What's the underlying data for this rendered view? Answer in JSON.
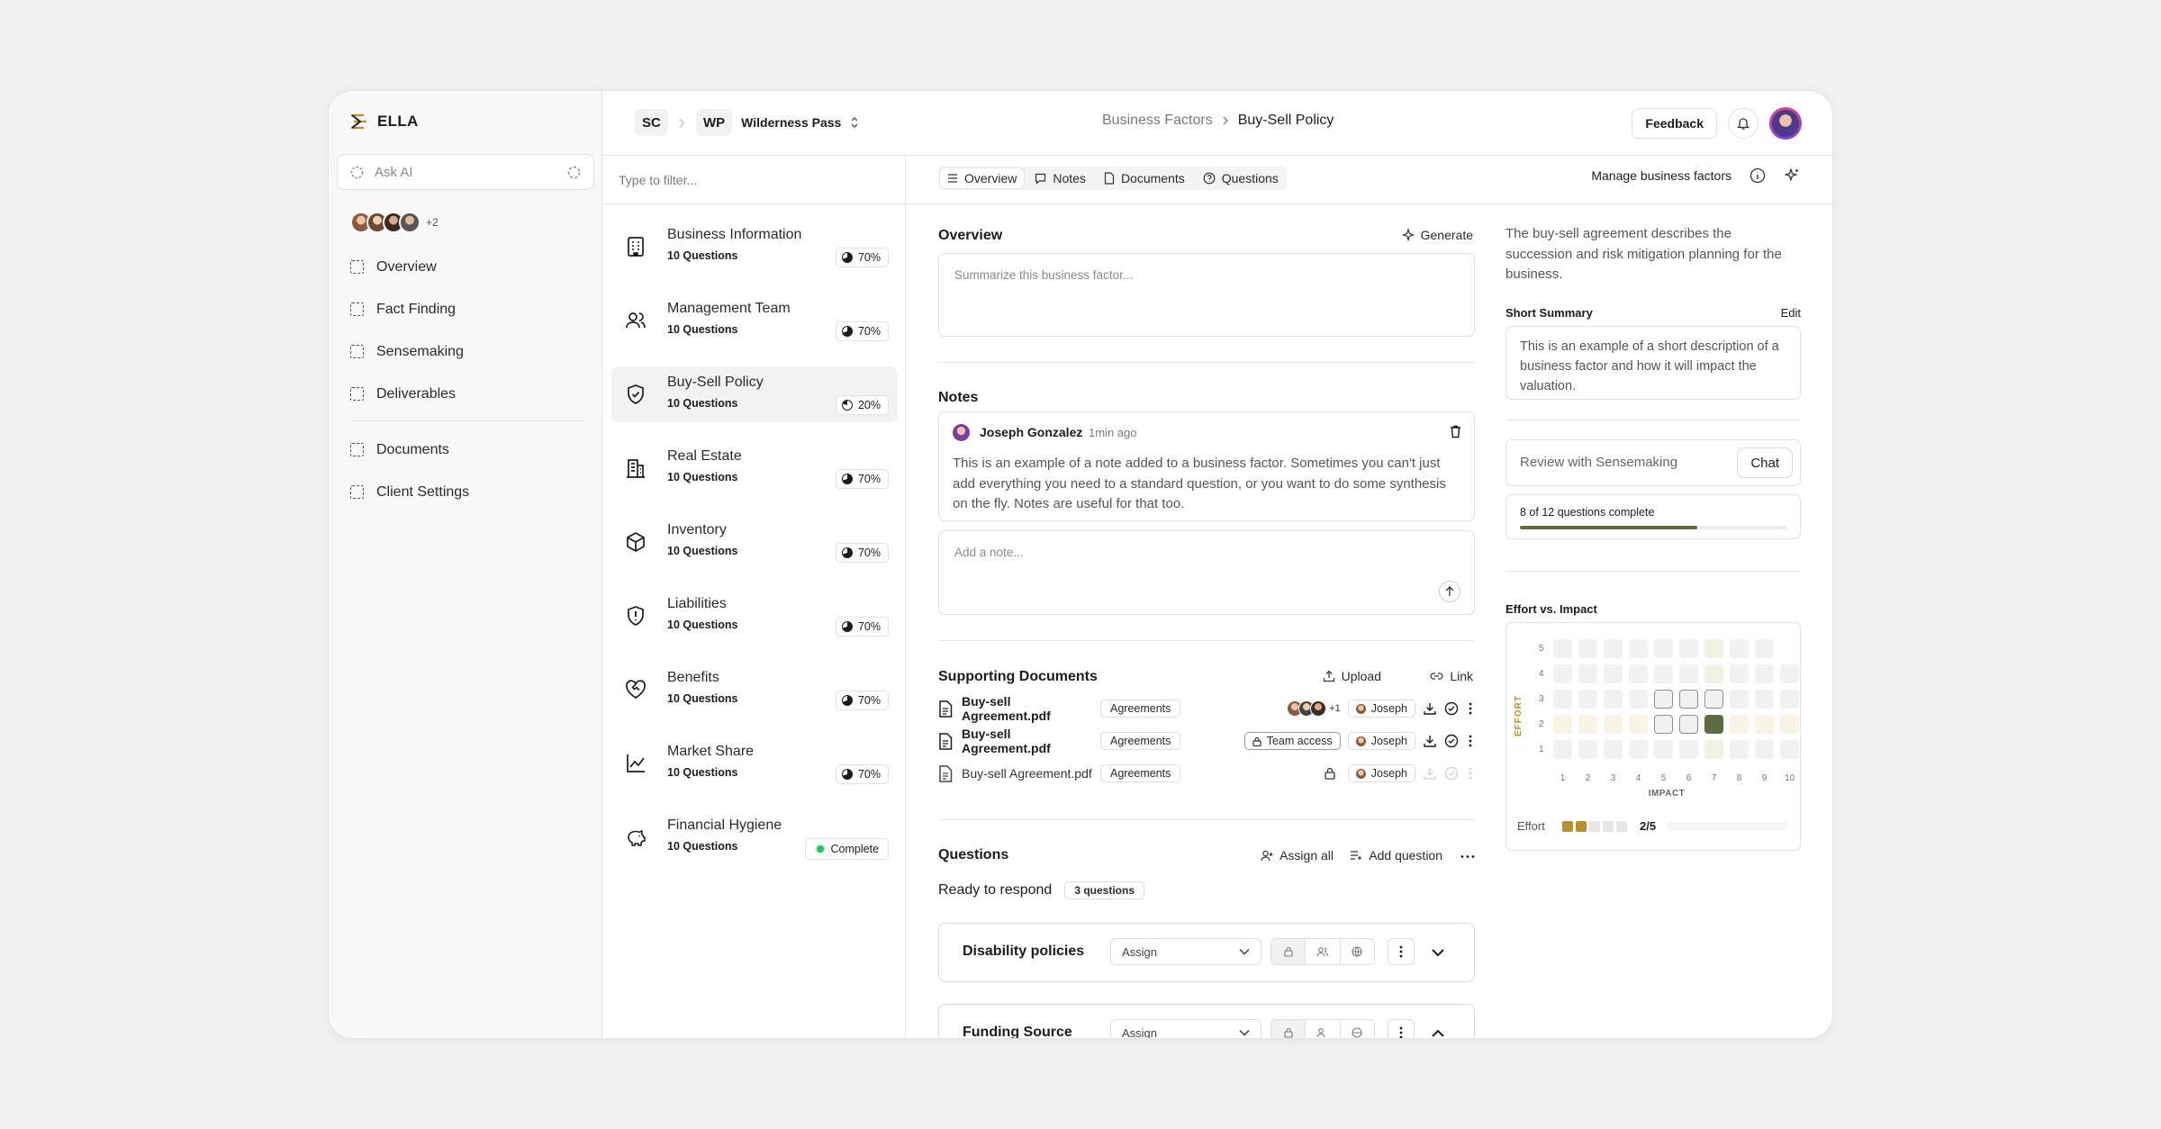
{
  "app": {
    "name": "ELLA"
  },
  "sidebar": {
    "ask_ai_placeholder": "Ask AI",
    "avatar_more": "+2",
    "nav": [
      "Overview",
      "Fact Finding",
      "Sensemaking",
      "Deliverables"
    ],
    "nav2": [
      "Documents",
      "Client Settings"
    ]
  },
  "topbar": {
    "org_badge": "SC",
    "workspace_badge": "WP",
    "workspace_name": "Wilderness Pass",
    "breadcrumb": [
      "Business Factors",
      "Buy-Sell Policy"
    ],
    "feedback": "Feedback"
  },
  "factors": {
    "filter_placeholder": "Type to filter...",
    "items": [
      {
        "title": "Business Information",
        "sub": "10 Questions",
        "pct": "70%"
      },
      {
        "title": "Management Team",
        "sub": "10 Questions",
        "pct": "70%"
      },
      {
        "title": "Buy-Sell Policy",
        "sub": "10 Questions",
        "pct": "20%"
      },
      {
        "title": "Real Estate",
        "sub": "10 Questions",
        "pct": "70%"
      },
      {
        "title": "Inventory",
        "sub": "10 Questions",
        "pct": "70%"
      },
      {
        "title": "Liabilities",
        "sub": "10 Questions",
        "pct": "70%"
      },
      {
        "title": "Benefits",
        "sub": "10 Questions",
        "pct": "70%"
      },
      {
        "title": "Market Share",
        "sub": "10 Questions",
        "pct": "70%"
      },
      {
        "title": "Financial Hygiene",
        "sub": "10 Questions",
        "pct": "Complete"
      }
    ]
  },
  "tabs": {
    "items": [
      "Overview",
      "Notes",
      "Documents",
      "Questions"
    ],
    "manage": "Manage business factors"
  },
  "overview": {
    "title": "Overview",
    "generate": "Generate",
    "placeholder": "Summarize this business factor..."
  },
  "notes": {
    "title": "Notes",
    "author": "Joseph Gonzalez",
    "time": "1min ago",
    "body": "This is an example of a note added to a business factor. Sometimes you can't just add everything you need to a standard question, or you want to do some synthesis on the fly. Notes are useful for that too.",
    "add_placeholder": "Add a note..."
  },
  "docs": {
    "title": "Supporting Documents",
    "upload": "Upload",
    "link": "Link",
    "rows": [
      {
        "file": "Buy-sell Agreement.pdf",
        "tag": "Agreements",
        "access": "+1",
        "owner": "Joseph"
      },
      {
        "file": "Buy-sell Agreement.pdf",
        "tag": "Agreements",
        "access": "Team access",
        "owner": "Joseph"
      },
      {
        "file": "Buy-sell Agreement.pdf",
        "tag": "Agreements",
        "access": "",
        "owner": "Joseph"
      }
    ]
  },
  "questions": {
    "title": "Questions",
    "assign_all": "Assign all",
    "add": "Add question",
    "status": "Ready to respond",
    "count": "3 questions",
    "cards": [
      {
        "title": "Disability policies",
        "assign": "Assign"
      },
      {
        "title": "Funding Source",
        "assign": "Assign"
      }
    ]
  },
  "panel": {
    "description": "The buy-sell agreement describes the succession and risk mitigation planning for the business.",
    "short_summary_label": "Short Summary",
    "edit": "Edit",
    "short_summary": "This is an example of a short description of a business factor and how it will impact the valuation.",
    "review_placeholder": "Review with Sensemaking",
    "chat": "Chat",
    "progress_text": "8 of 12 questions complete",
    "progress": 0.667,
    "effort_title": "Effort vs. Impact",
    "effort_label": "Effort",
    "effort_value": "2/5",
    "effort_level": 2,
    "y_axis": "EFFORT",
    "x_axis": "IMPACT",
    "y_ticks": [
      "5",
      "4",
      "3",
      "2",
      "1"
    ],
    "x_ticks": [
      "1",
      "2",
      "3",
      "4",
      "5",
      "6",
      "7",
      "8",
      "9",
      "10"
    ]
  },
  "colors": {
    "accent_green": "#5d6b3f",
    "effort_gold": "#b8912e",
    "status_green": "#22c55e"
  }
}
